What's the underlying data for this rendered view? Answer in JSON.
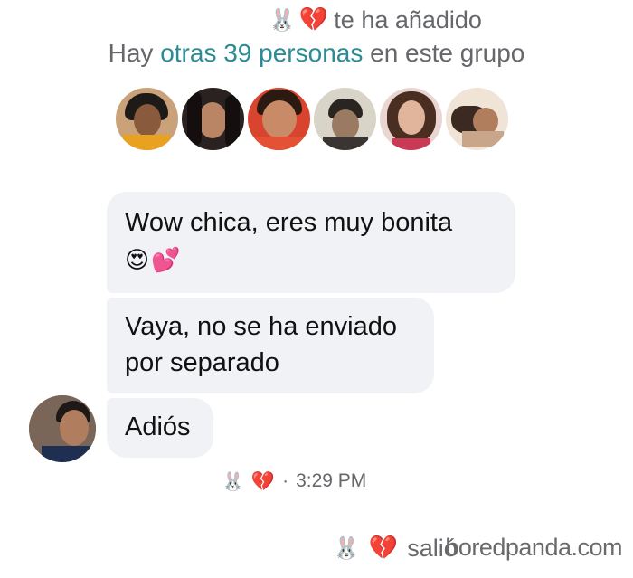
{
  "system": {
    "added_text": "te ha añadido",
    "group_prefix": "Hay",
    "group_link": "otras 39 personas",
    "group_suffix": "en este grupo"
  },
  "avatars_count": 6,
  "messages": [
    {
      "line1": "Wow chica, eres muy bonita",
      "emojis": "😍💕"
    },
    {
      "line1": "Vaya, no se ha enviado",
      "line2": "por separado"
    },
    {
      "line1": "Adiós"
    }
  ],
  "time": {
    "separator": "·",
    "value": "3:29 PM"
  },
  "left_event": {
    "text": "salió"
  },
  "watermark": "boredpanda.com",
  "icons": {
    "bunny": "🐰",
    "broken_heart": "💔"
  },
  "colors": {
    "link": "#2a8c95",
    "bubble": "#f0f2f5",
    "muted": "#65676b",
    "heart": "#e0245e"
  }
}
